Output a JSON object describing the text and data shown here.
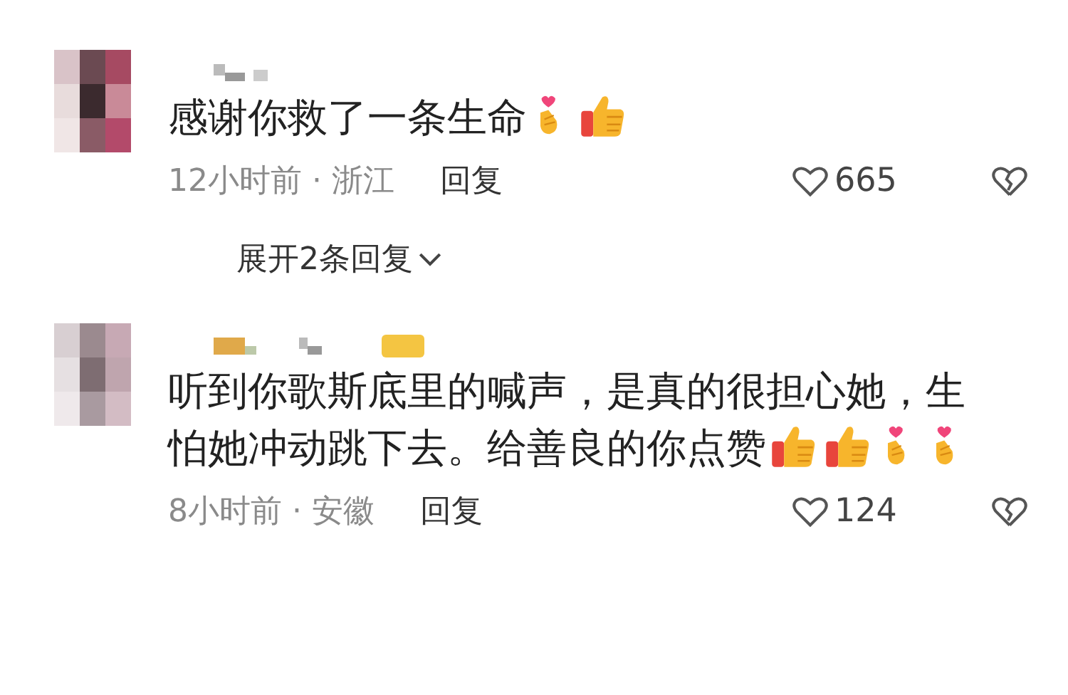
{
  "comments": [
    {
      "lines": [
        "感谢你救了一条生命"
      ],
      "emojis": [
        {
          "kind": "finger-heart"
        },
        {
          "kind": "thumbs-up"
        }
      ],
      "time_location": "12小时前 · 浙江",
      "reply": "回复",
      "likes": "665",
      "expand_replies": {
        "label": "展开2条回复"
      }
    },
    {
      "lines": [
        "听到你歌斯底里的喊声，是真的很担心她，生",
        "怕她冲动跳下去。给善良的你点赞"
      ],
      "emojis": [
        {
          "kind": "thumbs-up"
        },
        {
          "kind": "thumbs-up"
        },
        {
          "kind": "finger-heart"
        },
        {
          "kind": "finger-heart"
        }
      ],
      "time_location": "8小时前 · 安徽",
      "reply": "回复",
      "likes": "124"
    }
  ]
}
